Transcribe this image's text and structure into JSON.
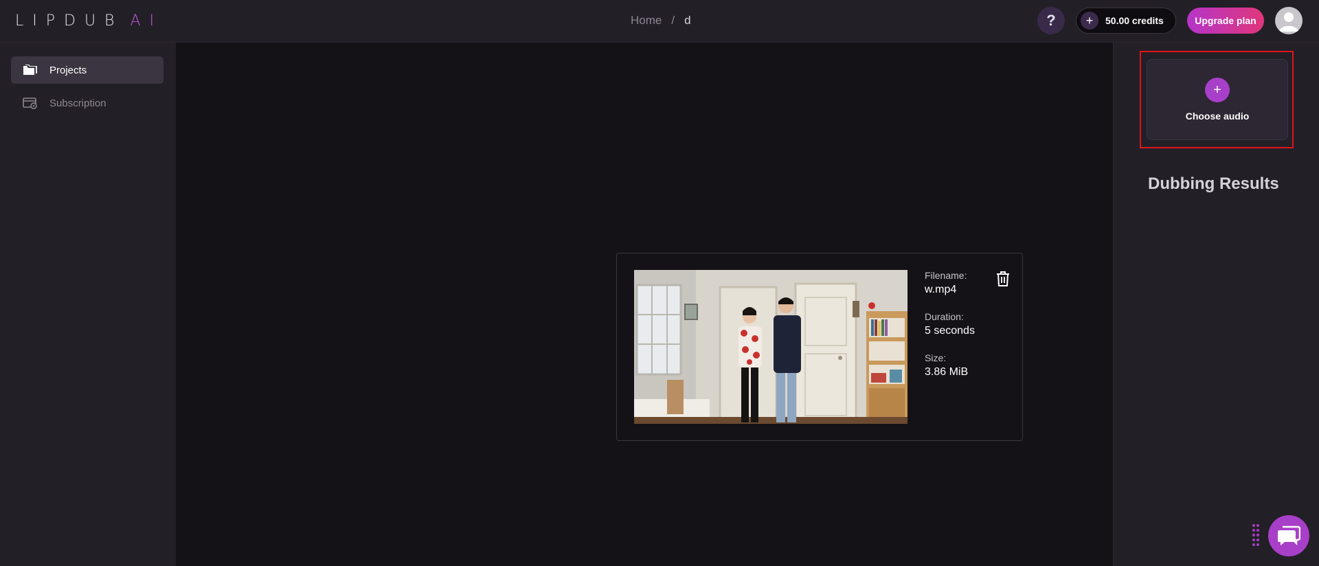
{
  "app": {
    "logo_main": "LIPDUB",
    "logo_ai": "AI"
  },
  "breadcrumb": {
    "home": "Home",
    "separator": "/",
    "current": "d"
  },
  "header": {
    "help_label": "?",
    "credits_plus": "+",
    "credits_label": "50.00 credits",
    "upgrade_label": "Upgrade plan"
  },
  "sidebar": {
    "items": [
      {
        "label": "Projects",
        "icon": "folder-icon",
        "active": true
      },
      {
        "label": "Subscription",
        "icon": "subscription-icon",
        "active": false
      }
    ]
  },
  "video": {
    "filename_label": "Filename:",
    "filename": "w.mp4",
    "duration_label": "Duration:",
    "duration": "5 seconds",
    "size_label": "Size:",
    "size": "3.86 MiB"
  },
  "right_panel": {
    "choose_plus": "+",
    "choose_label": "Choose audio",
    "results_title": "Dubbing Results"
  },
  "colors": {
    "accent": "#a83fc8",
    "upgrade_gradient_start": "#b535c9",
    "upgrade_gradient_end": "#e0367a",
    "highlight_outline": "#e0151b"
  }
}
